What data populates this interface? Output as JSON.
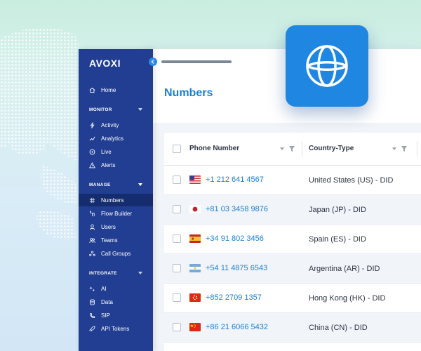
{
  "colors": {
    "brand_blue": "#1a7fd6",
    "sidebar_bg": "#213e92",
    "sidebar_active": "#152c6e",
    "globe_tile": "#1f87e1"
  },
  "sidebar": {
    "logo": "AVOXI",
    "home": {
      "label": "Home",
      "icon": "home-icon"
    },
    "sections": [
      {
        "label": "MONITOR",
        "items": [
          {
            "label": "Activity",
            "icon": "bolt-icon"
          },
          {
            "label": "Analytics",
            "icon": "analytics-icon"
          },
          {
            "label": "Live",
            "icon": "live-icon"
          },
          {
            "label": "Alerts",
            "icon": "alert-icon"
          }
        ]
      },
      {
        "label": "MANAGE",
        "items": [
          {
            "label": "Numbers",
            "icon": "hash-icon",
            "active": true
          },
          {
            "label": "Flow Builder",
            "icon": "flow-icon"
          },
          {
            "label": "Users",
            "icon": "user-icon"
          },
          {
            "label": "Teams",
            "icon": "team-icon"
          },
          {
            "label": "Call Groups",
            "icon": "call-groups-icon"
          }
        ]
      },
      {
        "label": "INTEGRATE",
        "items": [
          {
            "label": "AI",
            "icon": "sparkle-icon"
          },
          {
            "label": "Data",
            "icon": "database-icon"
          },
          {
            "label": "SIP",
            "icon": "sip-icon"
          },
          {
            "label": "API Tokens",
            "icon": "rocket-icon"
          }
        ]
      }
    ]
  },
  "main": {
    "title": "Numbers",
    "table": {
      "columns": [
        "Phone Number",
        "Country-Type"
      ],
      "rows": [
        {
          "flag": "us",
          "phone": "+1 212 641 4567",
          "country": "United States (US) - DID"
        },
        {
          "flag": "jp",
          "phone": "+81 03 3458 9876",
          "country": "Japan (JP) - DID"
        },
        {
          "flag": "es",
          "phone": "+34 91 802 3456",
          "country": "Spain (ES) - DID"
        },
        {
          "flag": "ar",
          "phone": "+54 11 4875 6543",
          "country": "Argentina (AR) - DID"
        },
        {
          "flag": "hk",
          "phone": "+852 2709 1357",
          "country": "Hong Kong (HK) - DID"
        },
        {
          "flag": "cn",
          "phone": "+86 21 6066 5432",
          "country": "China (CN) - DID"
        }
      ]
    }
  },
  "globe_tile": {
    "icon": "globe-icon"
  }
}
